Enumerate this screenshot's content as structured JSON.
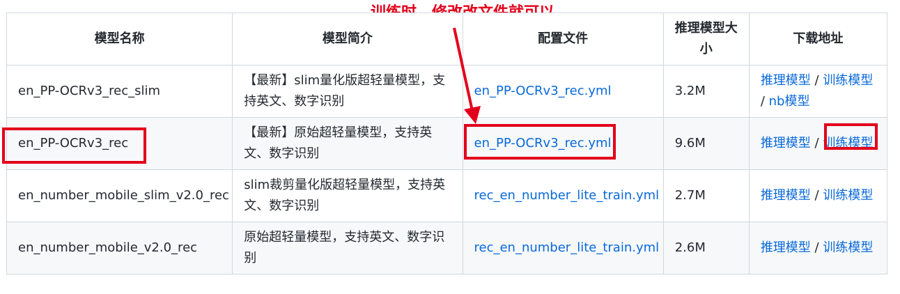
{
  "annotation": {
    "text": "训练时，修改改文件就可以",
    "color": "#e3001b"
  },
  "table": {
    "headers": [
      "模型名称",
      "模型简介",
      "配置文件",
      "推理模型大小",
      "下载地址"
    ],
    "rows": [
      {
        "name": "en_PP-OCRv3_rec_slim",
        "intro": "【最新】slim量化版超轻量模型，支持英文、数字识别",
        "config": "en_PP-OCRv3_rec.yml",
        "size": "3.2M",
        "links": [
          "推理模型",
          "训练模型",
          "nb模型"
        ]
      },
      {
        "name": "en_PP-OCRv3_rec",
        "intro": "【最新】原始超轻量模型，支持英文、数字识别",
        "config": "en_PP-OCRv3_rec.yml",
        "size": "9.6M",
        "links": [
          "推理模型",
          "训练模型"
        ]
      },
      {
        "name": "en_number_mobile_slim_v2.0_rec",
        "intro": "slim裁剪量化版超轻量模型，支持英文、数字识别",
        "config": "rec_en_number_lite_train.yml",
        "size": "2.7M",
        "links": [
          "推理模型",
          "训练模型"
        ]
      },
      {
        "name": "en_number_mobile_v2.0_rec",
        "intro": "原始超轻量模型，支持英文、数字识别",
        "config": "rec_en_number_lite_train.yml",
        "size": "2.6M",
        "links": [
          "推理模型",
          "训练模型"
        ]
      }
    ],
    "separator": " / ",
    "link_color": "#0969da"
  }
}
